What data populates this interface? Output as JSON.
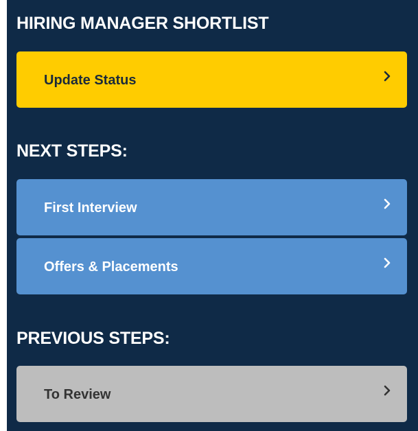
{
  "panel": {
    "title": "HIRING MANAGER SHORTLIST"
  },
  "current": {
    "update_status_label": "Update Status"
  },
  "next_steps": {
    "heading": "NEXT STEPS:",
    "items": [
      {
        "label": "First Interview"
      },
      {
        "label": "Offers & Placements"
      }
    ]
  },
  "previous_steps": {
    "heading": "PREVIOUS STEPS:",
    "items": [
      {
        "label": "To Review"
      }
    ]
  },
  "colors": {
    "panel_bg": "#0f2a47",
    "current_button": "#ffcc00",
    "next_button": "#5591d0",
    "previous_button": "#bdbdbd"
  },
  "icons": {
    "chevron": "chevron-right-icon"
  }
}
